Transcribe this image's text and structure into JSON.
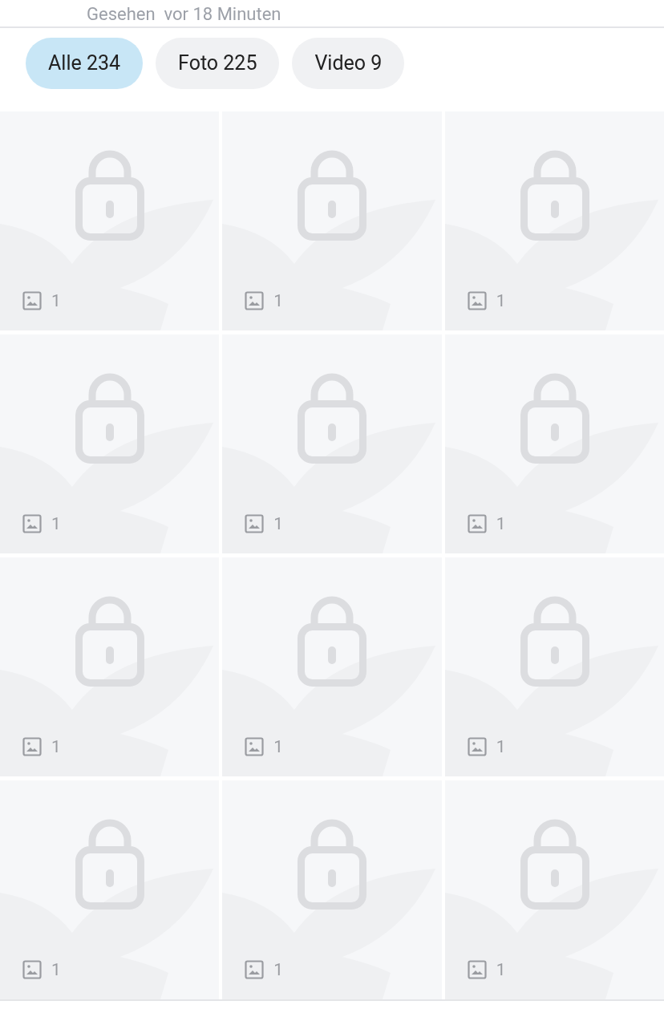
{
  "header": {
    "last_seen": "Gesehen  vor 18 Minuten"
  },
  "filters": [
    {
      "label": "Alle 234",
      "selected": true
    },
    {
      "label": "Foto 225",
      "selected": false
    },
    {
      "label": "Video 9",
      "selected": false
    }
  ],
  "tiles": [
    {
      "locked": true,
      "count": "1"
    },
    {
      "locked": true,
      "count": "1"
    },
    {
      "locked": true,
      "count": "1"
    },
    {
      "locked": true,
      "count": "1"
    },
    {
      "locked": true,
      "count": "1"
    },
    {
      "locked": true,
      "count": "1"
    },
    {
      "locked": true,
      "count": "1"
    },
    {
      "locked": true,
      "count": "1"
    },
    {
      "locked": true,
      "count": "1"
    },
    {
      "locked": true,
      "count": "1"
    },
    {
      "locked": true,
      "count": "1"
    },
    {
      "locked": true,
      "count": "1"
    }
  ]
}
